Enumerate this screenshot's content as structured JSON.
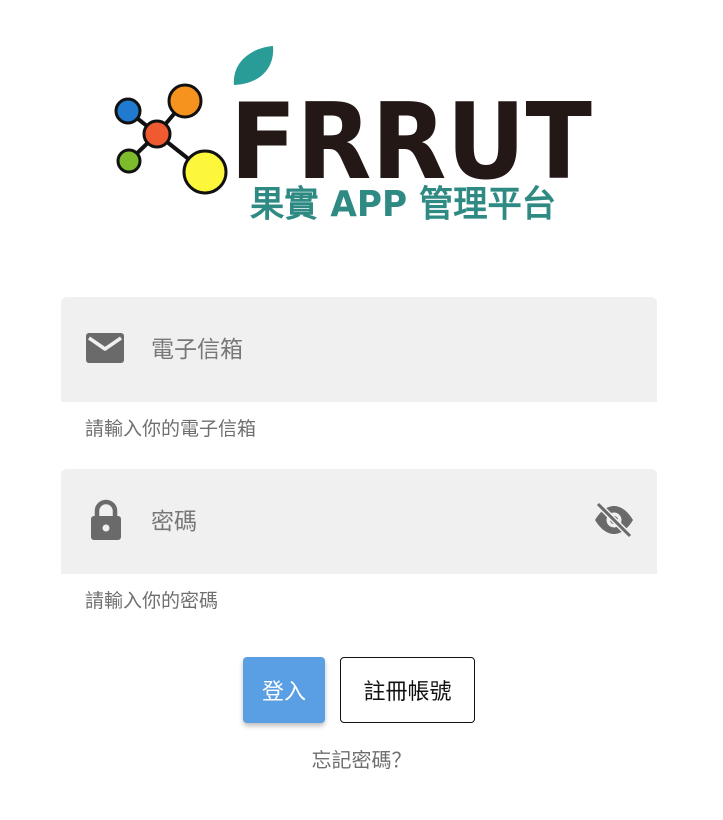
{
  "logo": {
    "wordmark": "FRRUT",
    "subtitle": "果實 APP 管理平台",
    "colors": {
      "wordmark": "#231816",
      "subtitle": "#2f8a84",
      "leaf": "#2a9c98"
    }
  },
  "email": {
    "icon": "mail-icon",
    "placeholder": "電子信箱",
    "value": "",
    "hint": "請輸入你的電子信箱"
  },
  "password": {
    "icon": "lock-icon",
    "placeholder": "密碼",
    "value": "",
    "hint": "請輸入你的密碼",
    "toggle_icon": "eye-off-icon"
  },
  "actions": {
    "login_label": "登入",
    "register_label": "註冊帳號",
    "forgot_label": "忘記密碼？"
  },
  "colors": {
    "primary": "#5a9fe4",
    "field_background": "#f0f0f0",
    "hint_text": "#6f6f6f"
  }
}
